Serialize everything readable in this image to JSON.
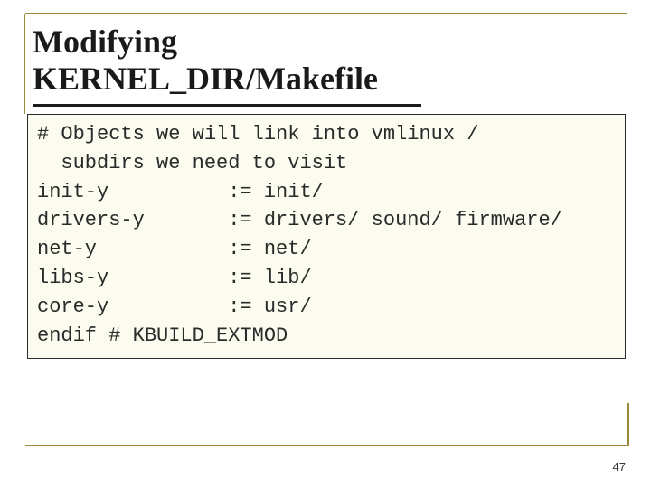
{
  "title_line1": "Modifying",
  "title_line2": "KERNEL_DIR/Makefile",
  "code": {
    "l1": "# Objects we will link into vmlinux /",
    "l2": "  subdirs we need to visit",
    "l3": "init-y          := init/",
    "l4": "drivers-y       := drivers/ sound/ firmware/",
    "l5": "net-y           := net/",
    "l6": "libs-y          := lib/",
    "l7": "core-y          := usr/",
    "l8": "endif # KBUILD_EXTMOD"
  },
  "page_number": "47"
}
